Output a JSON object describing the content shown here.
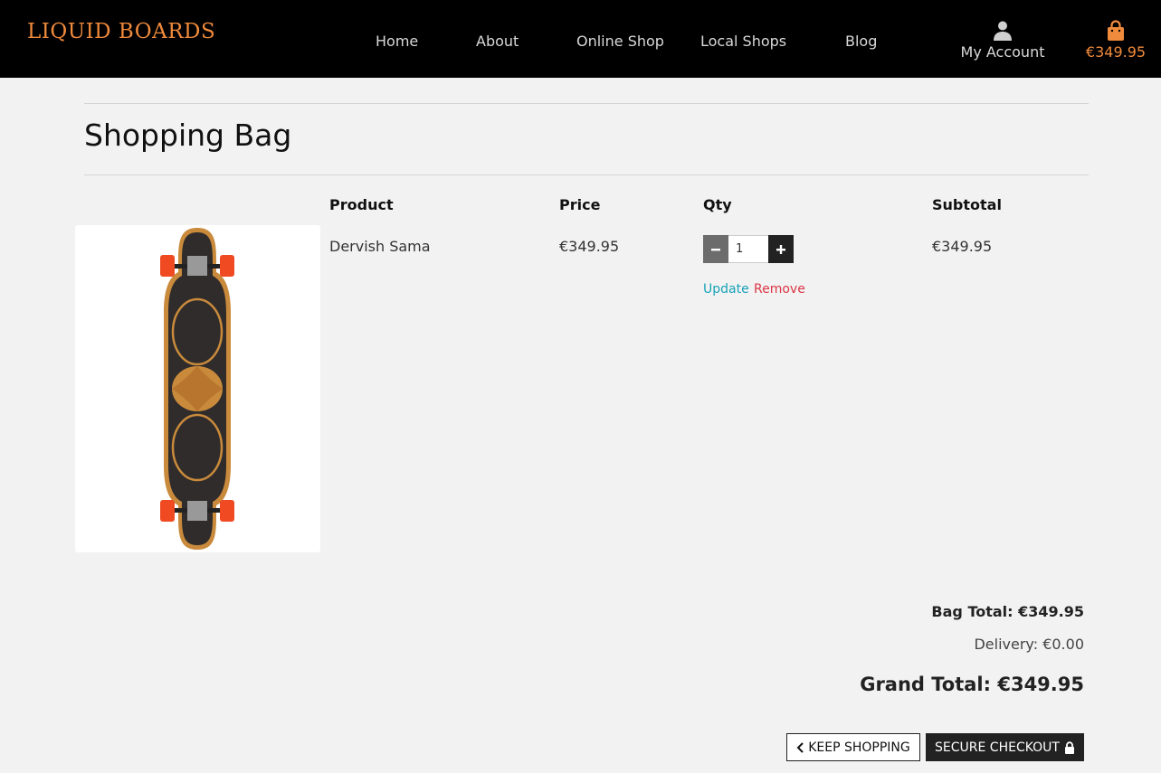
{
  "navbar": {
    "brand": "LIQUID BOARDS",
    "links": [
      "Home",
      "About",
      "Online Shop",
      "Local Shops",
      "Blog"
    ],
    "account_label": "My Account",
    "cart_total": "€349.95",
    "icons": {
      "account": "user-icon",
      "cart": "shopping-bag-icon"
    },
    "colors": {
      "brand": "#f08a3c",
      "background": "#000000"
    }
  },
  "page": {
    "title": "Shopping Bag"
  },
  "table": {
    "headers": {
      "product": "Product",
      "price": "Price",
      "qty": "Qty",
      "subtotal": "Subtotal"
    },
    "rows": [
      {
        "product": "Dervish Sama",
        "price": "€349.95",
        "qty": "1",
        "subtotal": "€349.95",
        "update_label": "Update",
        "remove_label": "Remove"
      }
    ]
  },
  "totals": {
    "bag_total": "Bag Total: €349.95",
    "delivery": "Delivery: €0.00",
    "grand_total": "Grand Total: €349.95"
  },
  "actions": {
    "keep_shopping": "KEEP SHOPPING",
    "secure_checkout": "SECURE CHECKOUT"
  }
}
